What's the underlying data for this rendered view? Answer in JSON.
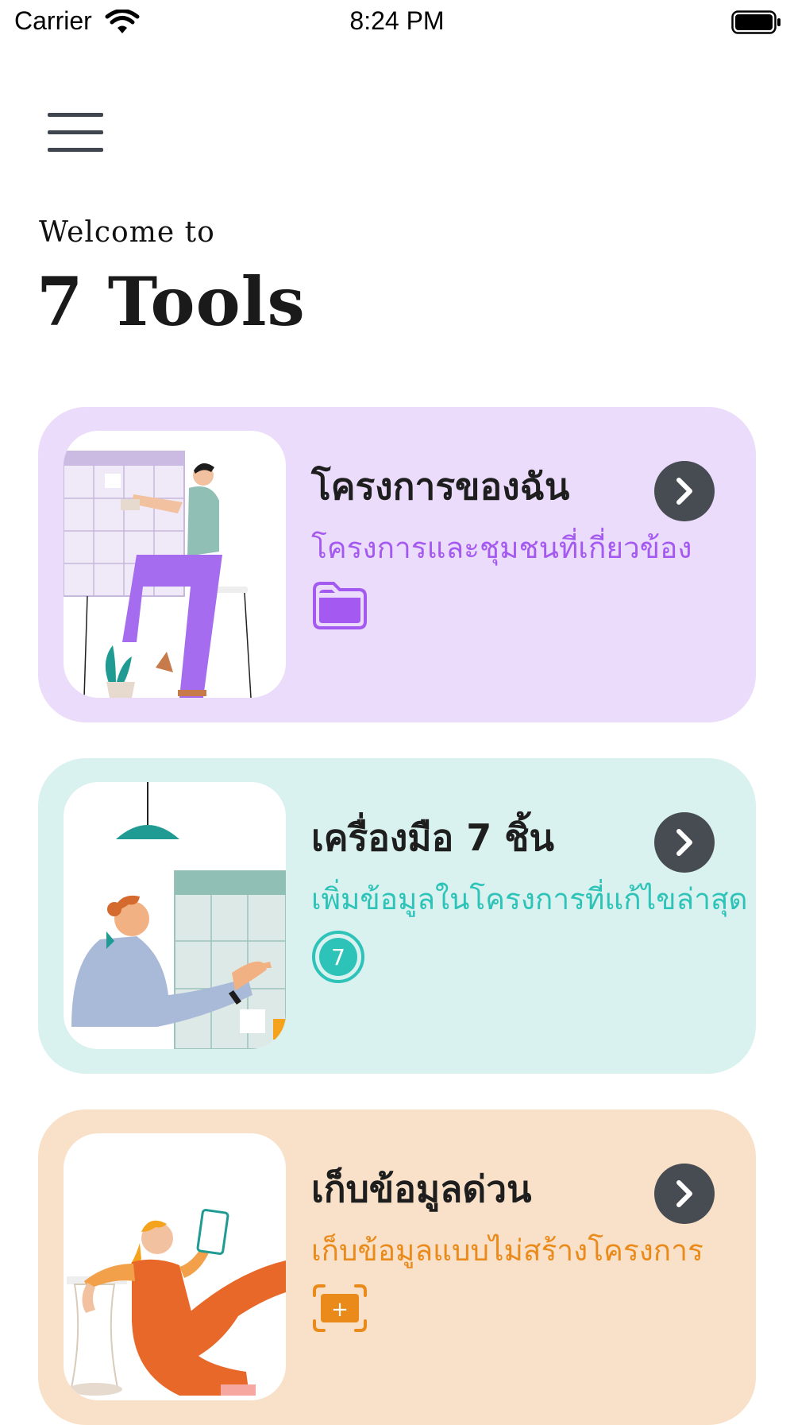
{
  "status_bar": {
    "carrier": "Carrier",
    "time": "8:24 PM",
    "icons": [
      "wifi-icon",
      "battery-icon"
    ]
  },
  "header": {
    "menu_icon": "hamburger-menu-icon",
    "welcome": "Welcome to",
    "title": "7 Tools"
  },
  "cards": [
    {
      "title": "โครงการของฉัน",
      "subtitle": "โครงการและชุมชนที่เกี่ยวข้อง",
      "icon": "folder-icon",
      "accent": "#a45af0",
      "background": "#ebdcfc"
    },
    {
      "title": "เครื่องมือ 7 ชิ้น",
      "subtitle": "เพิ่มข้อมูลในโครงการที่แก้ไขล่าสุด",
      "icon": "seven-badge-icon",
      "badge_text": "7",
      "accent": "#2dc3b8",
      "background": "#d9f2ef"
    },
    {
      "title": "เก็บข้อมูลด่วน",
      "subtitle": "เก็บข้อมูลแบบไม่สร้างโครงการ",
      "icon": "quick-add-icon",
      "badge_text": "+",
      "accent": "#ea8a1a",
      "background": "#f8e1c8"
    }
  ]
}
